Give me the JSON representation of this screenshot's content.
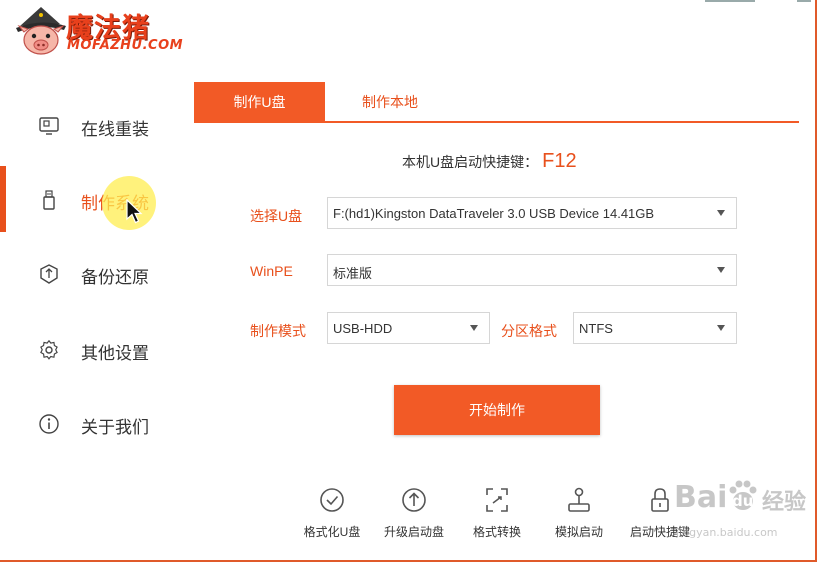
{
  "app": {
    "logo_name": "魔法猪",
    "logo_sub": "MOFAZHU.COM"
  },
  "sidebar": {
    "items": [
      {
        "label": "在线重装",
        "icon": "monitor-icon"
      },
      {
        "label": "制作系统",
        "icon": "usb-drive-icon",
        "active": true
      },
      {
        "label": "备份还原",
        "icon": "backup-restore-icon"
      },
      {
        "label": "其他设置",
        "icon": "gear-icon"
      },
      {
        "label": "关于我们",
        "icon": "info-icon"
      }
    ]
  },
  "tabs": [
    {
      "label": "制作U盘",
      "active": true
    },
    {
      "label": "制作本地",
      "active": false
    }
  ],
  "hotkey": {
    "label": "本机U盘启动快捷键：",
    "value": "F12"
  },
  "form": {
    "usb_label": "选择U盘",
    "usb_value": "F:(hd1)Kingston DataTraveler 3.0 USB Device 14.41GB",
    "winpe_label": "WinPE",
    "winpe_value": "标准版",
    "mode_label": "制作模式",
    "mode_value": "USB-HDD",
    "partition_label": "分区格式",
    "partition_value": "NTFS"
  },
  "start_button": "开始制作",
  "tools": [
    {
      "label": "格式化U盘",
      "icon": "check-circle-icon"
    },
    {
      "label": "升级启动盘",
      "icon": "upload-circle-icon"
    },
    {
      "label": "格式转换",
      "icon": "convert-icon"
    },
    {
      "label": "模拟启动",
      "icon": "joystick-icon"
    },
    {
      "label": "启动快捷键",
      "icon": "lock-icon"
    }
  ],
  "watermark": {
    "brand": "Bai",
    "brand2": "du",
    "cn": "经验",
    "url": "jingyan.baidu.com"
  },
  "colors": {
    "accent": "#f25a26",
    "accent_text": "#e8501c"
  }
}
